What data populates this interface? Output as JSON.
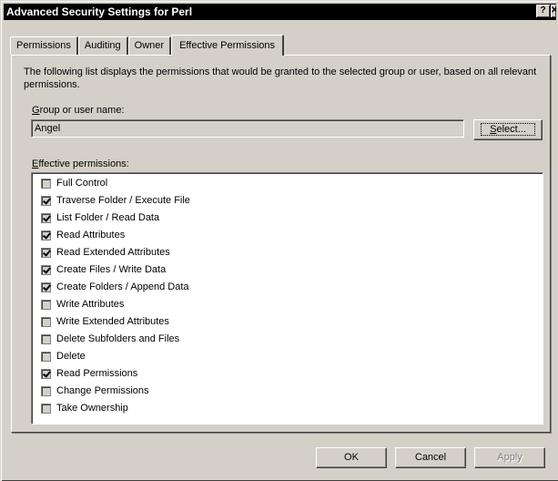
{
  "window": {
    "title": "Advanced Security Settings for Perl",
    "help_glyph": "?",
    "close_glyph": "✕"
  },
  "tabs": [
    {
      "label": "Permissions",
      "active": false
    },
    {
      "label": "Auditing",
      "active": false
    },
    {
      "label": "Owner",
      "active": false
    },
    {
      "label": "Effective Permissions",
      "active": true
    }
  ],
  "description": "The following list displays the permissions that would be granted to the selected group or user, based on all relevant permissions.",
  "group_label_accel": "G",
  "group_label_rest": "roup or user name:",
  "group_value": "Angel",
  "select_button_accel": "S",
  "select_button_rest": "elect...",
  "effective_label_accel": "E",
  "effective_label_rest": "ffective permissions:",
  "permissions": [
    {
      "label": "Full Control",
      "checked": false
    },
    {
      "label": "Traverse Folder / Execute File",
      "checked": true
    },
    {
      "label": "List Folder / Read Data",
      "checked": true
    },
    {
      "label": "Read Attributes",
      "checked": true
    },
    {
      "label": "Read Extended Attributes",
      "checked": true
    },
    {
      "label": "Create Files / Write Data",
      "checked": true
    },
    {
      "label": "Create Folders / Append Data",
      "checked": true
    },
    {
      "label": "Write Attributes",
      "checked": false
    },
    {
      "label": "Write Extended Attributes",
      "checked": false
    },
    {
      "label": "Delete Subfolders and Files",
      "checked": false
    },
    {
      "label": "Delete",
      "checked": false
    },
    {
      "label": "Read Permissions",
      "checked": true
    },
    {
      "label": "Change Permissions",
      "checked": false
    },
    {
      "label": "Take Ownership",
      "checked": false
    }
  ],
  "buttons": {
    "ok": "OK",
    "cancel": "Cancel",
    "apply": "Apply"
  }
}
